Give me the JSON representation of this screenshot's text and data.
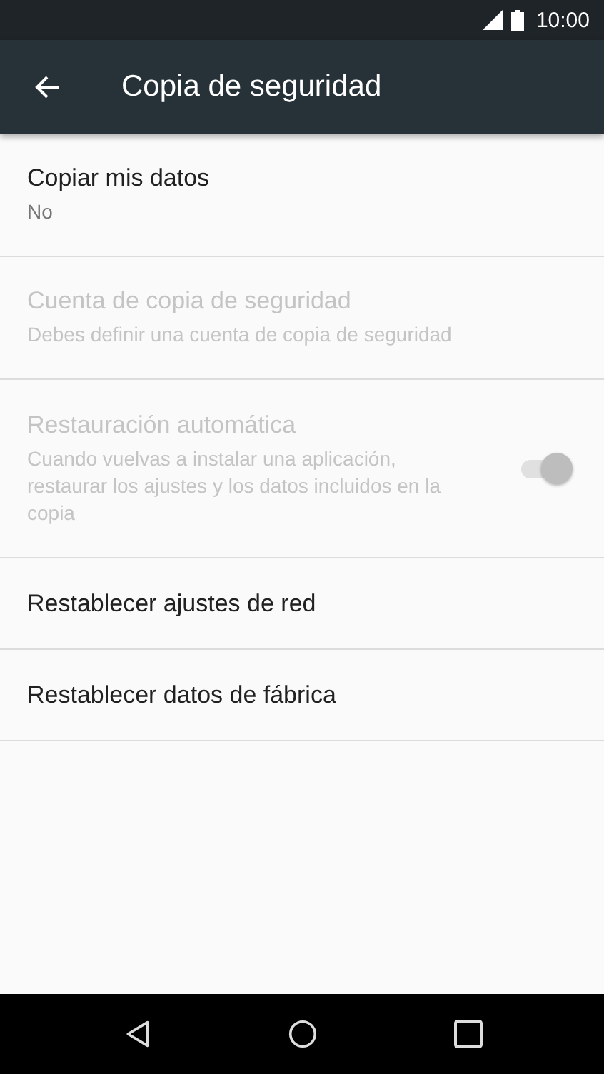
{
  "status_bar": {
    "time": "10:00"
  },
  "toolbar": {
    "title": "Copia de seguridad"
  },
  "items": [
    {
      "kind": "text",
      "title": "Copiar mis datos",
      "summary": "No",
      "disabled": false
    },
    {
      "kind": "text",
      "title": "Cuenta de copia de seguridad",
      "summary": "Debes definir una cuenta de copia de seguridad",
      "disabled": true
    },
    {
      "kind": "toggle",
      "title": "Restauración automática",
      "summary": "Cuando vuelvas a instalar una aplicación, restaurar los ajustes y los datos incluidos en la copia",
      "disabled": true,
      "on": true
    },
    {
      "kind": "text",
      "title": "Restablecer ajustes de red",
      "disabled": false
    },
    {
      "kind": "text",
      "title": "Restablecer datos de fábrica",
      "disabled": false
    }
  ]
}
